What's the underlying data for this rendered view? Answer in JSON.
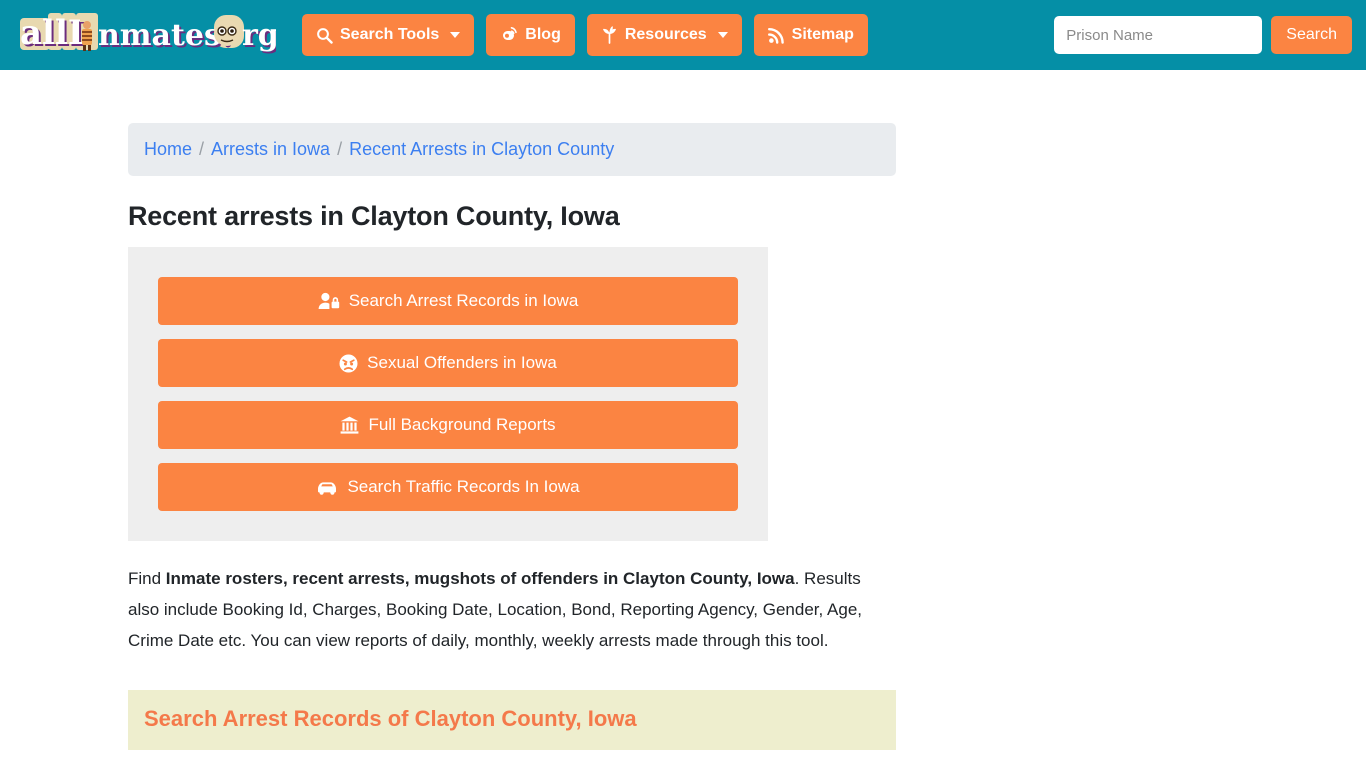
{
  "site": {
    "logo_text": "allInmates.org",
    "header_bg": "#058fa6",
    "accent_orange": "#fb8442"
  },
  "header": {
    "nav": [
      {
        "label": "Search Tools",
        "icon": "search-icon",
        "has_caret": true
      },
      {
        "label": "Blog",
        "icon": "blogger-icon",
        "has_caret": false
      },
      {
        "label": "Resources",
        "icon": "leaf-icon",
        "has_caret": true
      },
      {
        "label": "Sitemap",
        "icon": "rss-icon",
        "has_caret": false
      }
    ],
    "search": {
      "placeholder": "Prison Name",
      "value": "",
      "button_label": "Search"
    }
  },
  "breadcrumb": {
    "items": [
      {
        "label": "Home"
      },
      {
        "label": "Arrests in Iowa"
      },
      {
        "label": "Recent Arrests in Clayton County"
      }
    ],
    "separator": "/"
  },
  "main": {
    "page_title": "Recent arrests in Clayton County, Iowa",
    "action_buttons": [
      {
        "label": "Search Arrest Records in Iowa",
        "icon": "user-lock-icon"
      },
      {
        "label": "Sexual Offenders in Iowa",
        "icon": "angry-face-icon"
      },
      {
        "label": "Full Background Reports",
        "icon": "landmark-icon"
      },
      {
        "label": "Search Traffic Records In Iowa",
        "icon": "car-icon"
      }
    ],
    "lead": {
      "part1": "Find ",
      "bold": "Inmate rosters, recent arrests, mugshots of offenders in Clayton County, Iowa",
      "part2": ". Results also include Booking Id, Charges, Booking Date, Location, Bond, Reporting Agency, Gender, Age, Crime Date etc. You can view reports of daily, monthly, weekly arrests made through this tool."
    },
    "section_heading": "Search Arrest Records of Clayton County, Iowa"
  }
}
